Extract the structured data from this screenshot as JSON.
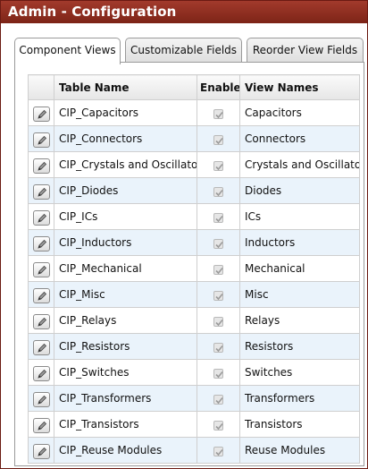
{
  "window": {
    "title": "Admin - Configuration"
  },
  "tabs": [
    {
      "label": "Component Views",
      "active": true
    },
    {
      "label": "Customizable Fields",
      "active": false
    },
    {
      "label": "Reorder View Fields",
      "active": false
    }
  ],
  "table": {
    "headers": {
      "table_name": "Table Name",
      "enable": "Enable",
      "view_names": "View Names"
    },
    "rows": [
      {
        "table_name": "CIP_Capacitors",
        "enabled": true,
        "view_name": "Capacitors"
      },
      {
        "table_name": "CIP_Connectors",
        "enabled": true,
        "view_name": "Connectors"
      },
      {
        "table_name": "CIP_Crystals and Oscillators",
        "enabled": true,
        "view_name": "Crystals and Oscillators"
      },
      {
        "table_name": "CIP_Diodes",
        "enabled": true,
        "view_name": "Diodes"
      },
      {
        "table_name": "CIP_ICs",
        "enabled": true,
        "view_name": "ICs"
      },
      {
        "table_name": "CIP_Inductors",
        "enabled": true,
        "view_name": "Inductors"
      },
      {
        "table_name": "CIP_Mechanical",
        "enabled": true,
        "view_name": "Mechanical"
      },
      {
        "table_name": "CIP_Misc",
        "enabled": true,
        "view_name": "Misc"
      },
      {
        "table_name": "CIP_Relays",
        "enabled": true,
        "view_name": "Relays"
      },
      {
        "table_name": "CIP_Resistors",
        "enabled": true,
        "view_name": "Resistors"
      },
      {
        "table_name": "CIP_Switches",
        "enabled": true,
        "view_name": "Switches"
      },
      {
        "table_name": "CIP_Transformers",
        "enabled": true,
        "view_name": "Transformers"
      },
      {
        "table_name": "CIP_Transistors",
        "enabled": true,
        "view_name": "Transistors"
      },
      {
        "table_name": "CIP_Reuse Modules",
        "enabled": true,
        "view_name": "Reuse Modules"
      }
    ]
  },
  "icons": {
    "edit": "pencil-icon",
    "check": "checkmark-icon"
  },
  "colors": {
    "titlebar": "#8b2c1e",
    "title_text": "#ffffff",
    "alt_row": "#eaf3fb",
    "grid_border": "#cfcfcf"
  }
}
